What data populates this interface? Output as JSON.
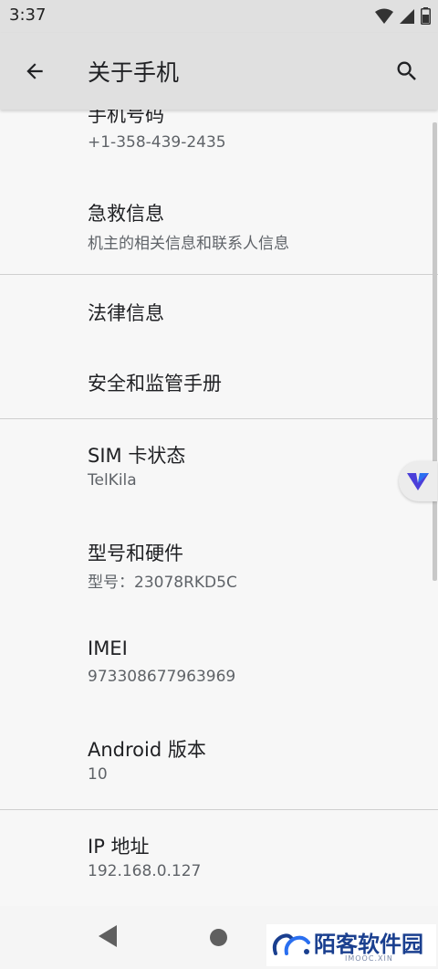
{
  "status_bar": {
    "time": "3:37",
    "icons": [
      "wifi-icon",
      "signal-icon",
      "battery-icon"
    ]
  },
  "app_bar": {
    "title": "关于手机",
    "back_icon": "arrow-back-icon",
    "search_icon": "search-icon"
  },
  "items": [
    {
      "id": "phone-number",
      "title": "手机号码",
      "summary": "+1-358-439-2435"
    },
    {
      "id": "emergency-info",
      "title": "急救信息",
      "summary": "机主的相关信息和联系人信息"
    },
    {
      "id": "legal-info",
      "title": "法律信息"
    },
    {
      "id": "safety-manual",
      "title": "安全和监管手册"
    },
    {
      "id": "sim-status",
      "title": "SIM 卡状态",
      "summary": "TelKila"
    },
    {
      "id": "model-hardware",
      "title": "型号和硬件",
      "summary": "型号：23078RKD5C"
    },
    {
      "id": "imei",
      "title": "IMEI",
      "summary": "973308677963969"
    },
    {
      "id": "android-version",
      "title": "Android 版本",
      "summary": "10"
    },
    {
      "id": "ip-address",
      "title": "IP 地址",
      "summary": "192.168.0.127"
    }
  ],
  "floating_button": {
    "icon": "v-logo-icon"
  },
  "nav_bar": {
    "icons": [
      "nav-back-icon",
      "nav-home-icon"
    ]
  },
  "watermark": {
    "text": "陌客软件园",
    "subtext": "IMOOC.XIN",
    "color": "#1a3f8f"
  },
  "colors": {
    "app_bar": "#e0e0e0",
    "background": "#f7f7f7",
    "title_text": "#202124",
    "summary_text": "#5f6368"
  }
}
